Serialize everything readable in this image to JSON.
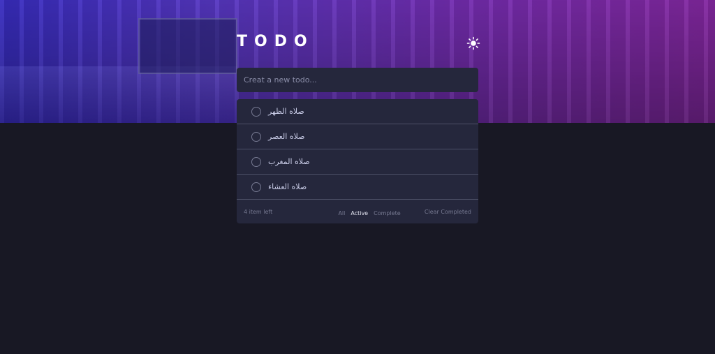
{
  "header": {
    "title": "TODO",
    "theme_icon": "sun-icon"
  },
  "new_todo": {
    "placeholder": "Creat a new todo..."
  },
  "todos": [
    {
      "text": "صلاه الظهر",
      "completed": false
    },
    {
      "text": "صلاه العصر",
      "completed": false
    },
    {
      "text": "صلاه المغرب",
      "completed": false
    },
    {
      "text": "صلاه العشاء",
      "completed": false
    }
  ],
  "footer": {
    "items_left": "4 item left",
    "filters": [
      {
        "label": "All",
        "active": false
      },
      {
        "label": "Active",
        "active": true
      },
      {
        "label": "Complete",
        "active": false
      }
    ],
    "clear_label": "Clear Completed"
  },
  "colors": {
    "background": "#181824",
    "card": "#25273c",
    "text": "#cacde8",
    "muted": "#777a92",
    "active_filter": "#e4e5f1"
  }
}
